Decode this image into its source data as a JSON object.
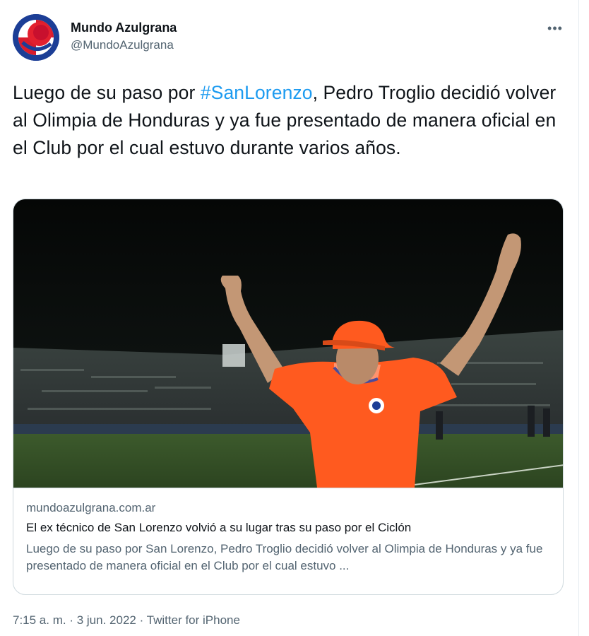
{
  "author": {
    "display_name": "Mundo Azulgrana",
    "handle": "@MundoAzulgrana",
    "avatar_icon": "club-crest-avatar"
  },
  "more_menu": {
    "icon": "more-dots-icon",
    "glyph": "•••"
  },
  "tweet": {
    "text_before": "Luego de su paso por ",
    "hashtag": "#SanLorenzo",
    "text_after": ", Pedro Troglio decidió volver al Olimpia de Honduras y ya fue presentado de manera oficial en el Club por el cual estuvo durante varios años."
  },
  "card": {
    "domain": "mundoazulgrana.com.ar",
    "title": "El ex técnico de San Lorenzo volvió a su lugar tras su paso por el Ciclón",
    "description": "Luego de su paso por San Lorenzo, Pedro Troglio decidió volver al Olimpia de Honduras y ya fue presentado de manera oficial en el Club por el cual estuvo ..."
  },
  "footer": {
    "time": "7:15 a. m.",
    "separator": " · ",
    "date": "3 jun. 2022",
    "source": "Twitter for iPhone"
  },
  "colors": {
    "link": "#1d9bf0",
    "text": "#0f1419",
    "secondary": "#536471",
    "border": "#cfd9de",
    "jersey": "#ff5a1f"
  }
}
